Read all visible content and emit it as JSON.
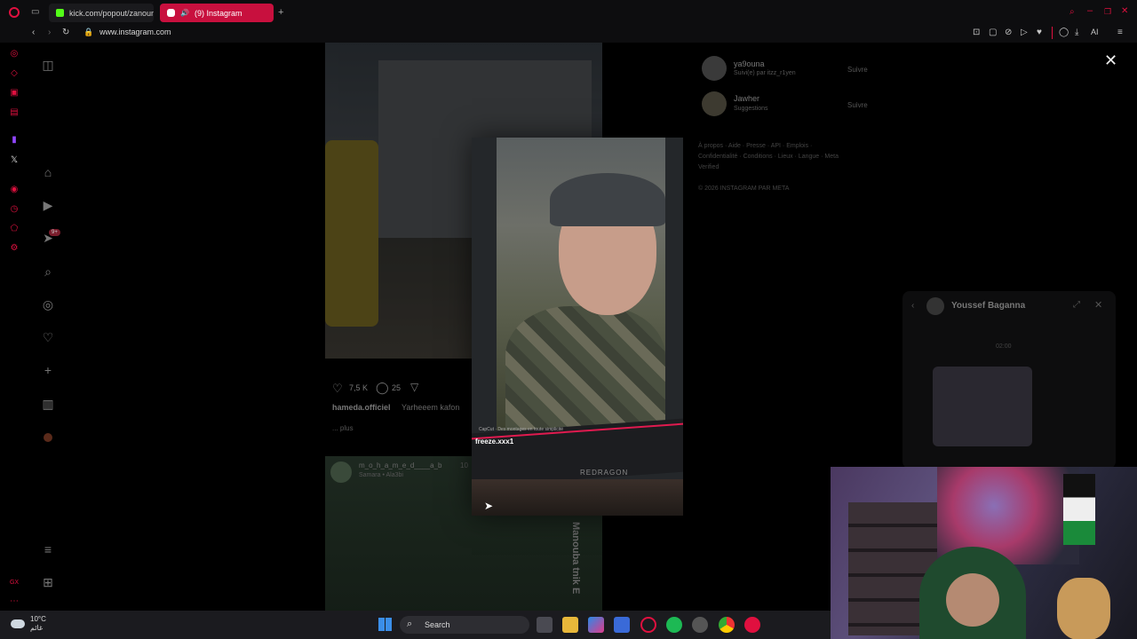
{
  "browser": {
    "tabs": [
      {
        "label": "kick.com/popout/zanoun/"
      },
      {
        "label": "(9) Instagram"
      }
    ],
    "url": "www.instagram.com"
  },
  "post1": {
    "likes": "7,5 K",
    "comments": "25",
    "author": "hameda.officiel",
    "caption": "Yarheeem kafon",
    "more": "... plus"
  },
  "post2": {
    "author": "m_o_h_a_m_e_d____a_b",
    "time": "10",
    "location": "Samara • Ala3bi",
    "overlay": "Manouba tnik E"
  },
  "suggestions": [
    {
      "name": "ya9ouna",
      "sub": "Suivi(e) par itzz_r1yen",
      "action": "Suivre"
    },
    {
      "name": "Jawher",
      "sub": "Suggestions",
      "action": "Suivre"
    }
  ],
  "footer": {
    "links": "À propos · Aide · Presse · API · Emplois · Confidentialité · Conditions · Lieux · Langue · Meta Verified",
    "copyright": "© 2026 INSTAGRAM PAR META"
  },
  "video": {
    "capcut": "CapCut · Des montages en toute simplicité",
    "title": "freeze.xxx1",
    "brand": "REDRAGON"
  },
  "dm": {
    "name": "Youssef Baganna",
    "time": "02:00"
  },
  "taskbar": {
    "temp": "10°C",
    "weather_label": "غائم",
    "search": "Search"
  },
  "notification_badge": "9+"
}
